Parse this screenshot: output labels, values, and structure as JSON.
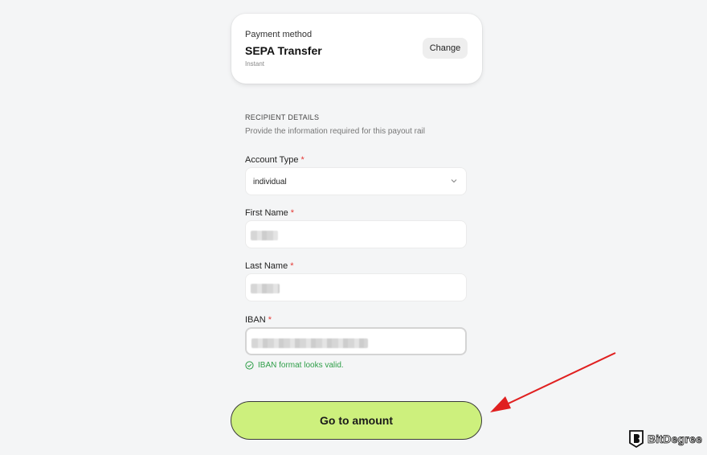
{
  "payment": {
    "label": "Payment method",
    "name": "SEPA Transfer",
    "sub": "Instant",
    "change_label": "Change"
  },
  "recipient": {
    "title": "RECIPIENT DETAILS",
    "subtitle": "Provide the information required for this payout rail"
  },
  "fields": {
    "account_type": {
      "label": "Account Type",
      "required": "*",
      "value": "individual"
    },
    "first_name": {
      "label": "First Name",
      "required": "*"
    },
    "last_name": {
      "label": "Last Name",
      "required": "*"
    },
    "iban": {
      "label": "IBAN",
      "required": "*"
    }
  },
  "validation": {
    "message": "IBAN format looks valid."
  },
  "cta": {
    "label": "Go to amount"
  },
  "watermark": {
    "text": "BitDegree"
  },
  "colors": {
    "accent": "#cdf07d",
    "success": "#2e9e48",
    "required": "#e53935",
    "annotation": "#e02020"
  },
  "icons": [
    "chevron-down-icon",
    "check-circle-icon",
    "annotation-arrow-icon",
    "bitdegree-logo-icon"
  ]
}
